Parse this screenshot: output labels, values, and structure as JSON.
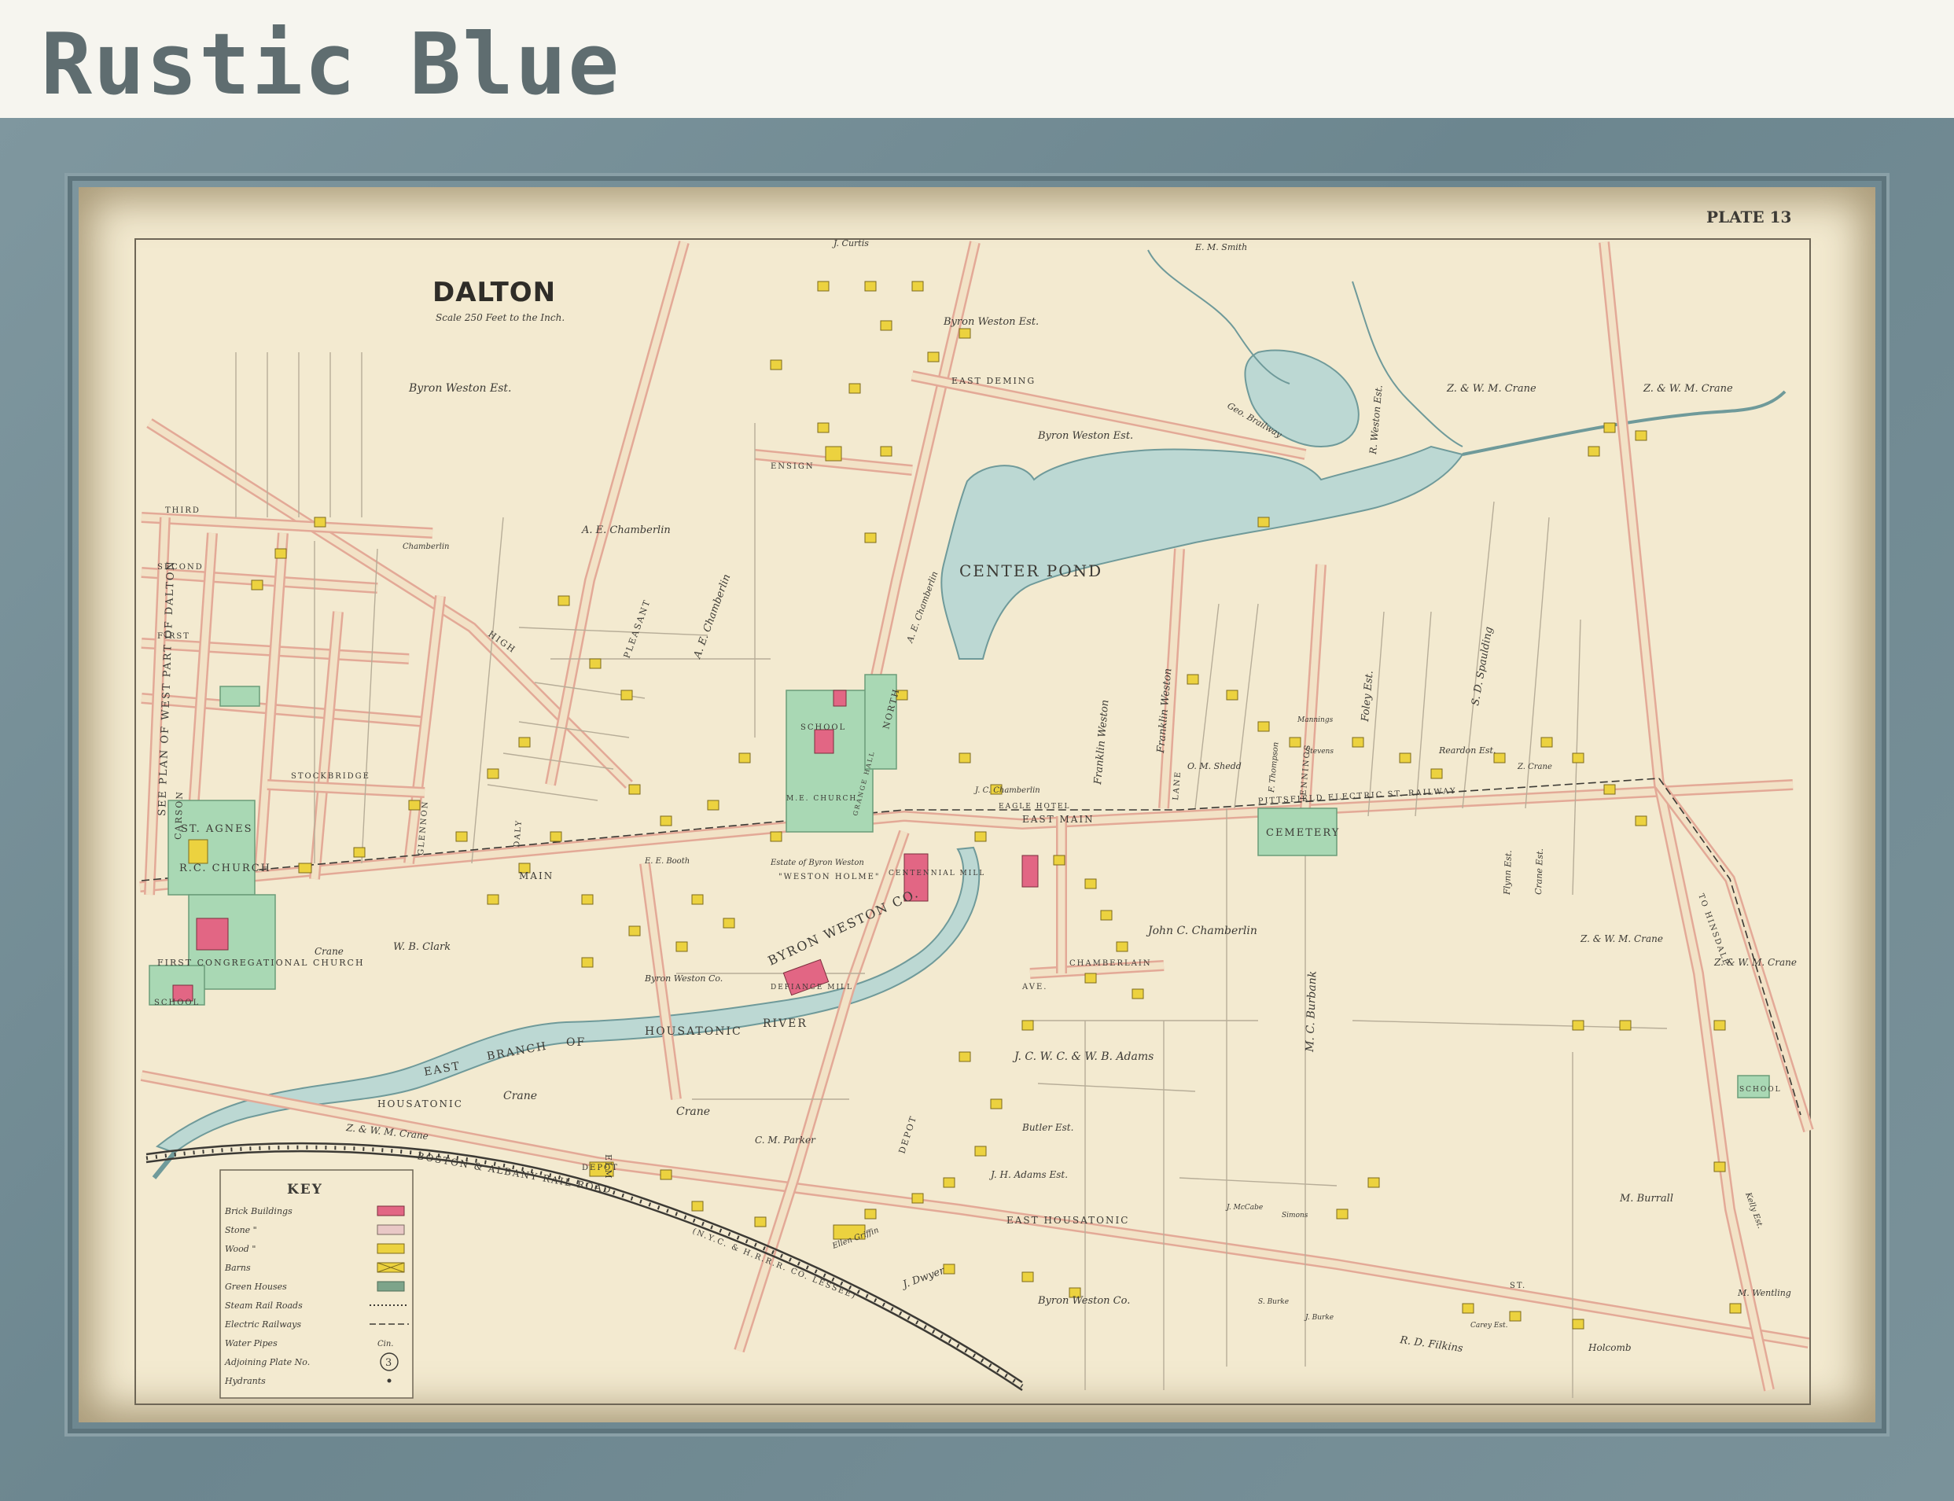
{
  "frame_style": "Rustic Blue",
  "map": {
    "title": "DALTON",
    "scale": "Scale 250 Feet to the Inch.",
    "plate": "PLATE 13",
    "water_labels": {
      "center_pond": "CENTER POND",
      "river": [
        "EAST",
        "BRANCH",
        "OF",
        "HOUSATONIC",
        "RIVER"
      ]
    },
    "streets": {
      "main": "MAIN",
      "east_main": "EAST MAIN",
      "housatonic": "HOUSATONIC",
      "east_housatonic": "EAST HOUSATONIC",
      "high": "HIGH",
      "pleasant": "PLEASANT",
      "north": "NORTH",
      "depot": "DEPOT",
      "elm": "ELM",
      "carson": "CARSON",
      "third": "THIRD",
      "second": "SECOND",
      "first": "FIRST",
      "east_deming": "EAST DEMING",
      "ensign": "ENSIGN",
      "chamberlain": "CHAMBERLAIN",
      "jennings": "JENNINGS",
      "lane": "LANE",
      "glennon": "GLENNON",
      "daly": "DALY",
      "stockbridge": "STOCKBRIDGE",
      "st": "ST.",
      "ave": "AVE."
    },
    "railways": {
      "boston_albany": "BOSTON & ALBANY RAIL ROAD",
      "lessee": "(N.Y.C. & H.R.R.R. CO. LESSEE)",
      "electric": "PITTSFIELD ELECTRIC ST. RAILWAY",
      "hinsdale": "TO HINSDALE"
    },
    "landmarks": {
      "st_agnes": "ST. AGNES",
      "rc_church": "R.C. CHURCH",
      "first_congregational": "FIRST CONGREGATIONAL CHURCH",
      "school": "SCHOOL",
      "cemetery": "CEMETERY",
      "centennial_mill": "CENTENNIAL MILL",
      "defiance_mill": "DEFIANCE MILL",
      "byron_weston_co": "BYRON WESTON CO.",
      "weston_holme": "\"WESTON HOLME\"",
      "depot": "DEPOT",
      "me_church": "M.E. CHURCH",
      "grange_hall": "GRANGE HALL",
      "eagle_hotel": "EAGLE HOTEL",
      "see_plan": "SEE PLAN OF WEST PART OF DALTON"
    },
    "owners": [
      "Byron Weston Est.",
      "J. Curtis",
      "E. M. Smith",
      "Z. & W. M. Crane",
      "A. E. Chamberlin",
      "Geo. Brailway",
      "R. Weston Est.",
      "Franklin Weston",
      "Foley Est.",
      "S. D. Spaulding",
      "John C. Chamberlin",
      "M. C. Burbank",
      "J. C. W. C. & W. B. Adams",
      "Crane",
      "Z. & W. M. Crane",
      "Byron Weston Co.",
      "M. Burrall",
      "R. D. Filkins",
      "Holcomb",
      "M. Wentling",
      "J. Dwyer",
      "Butler Est.",
      "C. M. Parker",
      "J. H. Adams Est.",
      "Reardon Est.",
      "O. M. Shedd",
      "Flynn Est.",
      "Crane Est.",
      "W. B. Clark",
      "E. E. Booth",
      "Estate of Byron Weston",
      "J. C. Chamberlin",
      "Chamberlin",
      "F. Thompson",
      "Mannings",
      "Stevens",
      "Z. Crane",
      "Kelly Est.",
      "Ellen Griffin",
      "J. McCabe",
      "Simons",
      "S. Burke",
      "J. Burke",
      "Carey Est."
    ]
  },
  "key": {
    "title": "KEY",
    "items": [
      {
        "label": "Brick Buildings",
        "swatch": "brick",
        "color": "#e26684"
      },
      {
        "label": "Stone \"",
        "swatch": "stone",
        "color": "#e9c8c6"
      },
      {
        "label": "Wood \"",
        "swatch": "wood",
        "color": "#ecd23f"
      },
      {
        "label": "Barns",
        "swatch": "barn",
        "color": "#ecd23f"
      },
      {
        "label": "Green Houses",
        "swatch": "greenhouse",
        "color": "#7da48a"
      },
      {
        "label": "Steam Rail Roads",
        "swatch": "steam-line"
      },
      {
        "label": "Electric Railways",
        "swatch": "electric-line"
      },
      {
        "label": "Water Pipes",
        "swatch": "water-pipe",
        "note": "Cin."
      },
      {
        "label": "Adjoining Plate No.",
        "swatch": "circle",
        "note": "3"
      },
      {
        "label": "Hydrants",
        "swatch": "dot"
      }
    ]
  }
}
